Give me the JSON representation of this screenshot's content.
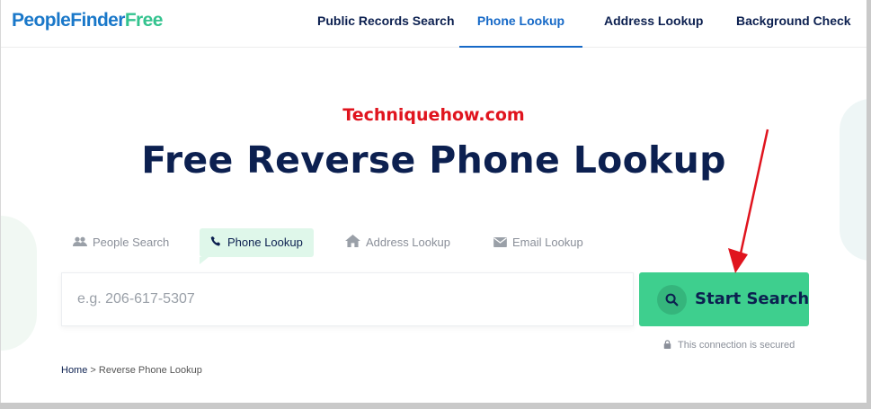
{
  "header": {
    "logo_part1": "PeopleFinder",
    "logo_part2": "Free",
    "nav": [
      {
        "label": "Public Records Search"
      },
      {
        "label": "Phone Lookup"
      },
      {
        "label": "Address Lookup"
      },
      {
        "label": "Background Check"
      }
    ],
    "active_nav": "Phone Lookup"
  },
  "watermark": "Techniquehow.com",
  "hero": {
    "title": "Free Reverse Phone Lookup"
  },
  "tabs": [
    {
      "label": "People Search",
      "icon": "people-icon"
    },
    {
      "label": "Phone Lookup",
      "icon": "phone-icon"
    },
    {
      "label": "Address Lookup",
      "icon": "home-icon"
    },
    {
      "label": "Email Lookup",
      "icon": "envelope-icon"
    }
  ],
  "active_tab": "Phone Lookup",
  "search": {
    "placeholder": "e.g. 206-617-5307",
    "button_label": "Start Search",
    "secured_text": "This connection is secured"
  },
  "breadcrumb": {
    "home": "Home",
    "separator": ">",
    "current": "Reverse Phone Lookup"
  },
  "colors": {
    "brand_blue": "#1a78c9",
    "brand_green": "#34c38f",
    "navy": "#0c2050",
    "button_green": "#3ecf8e",
    "annotation_red": "#e0141e"
  }
}
